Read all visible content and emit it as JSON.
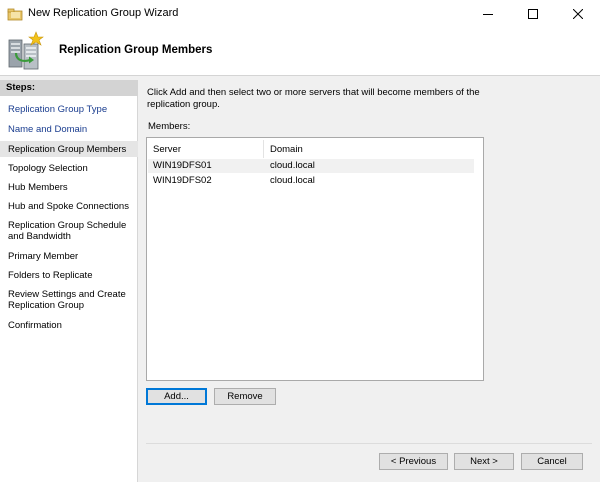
{
  "window": {
    "title": "New Replication Group Wizard",
    "app_icon": "wizard-app-icon",
    "controls": {
      "minimize": "minimize-icon",
      "maximize": "maximize-icon",
      "close": "close-icon"
    }
  },
  "header": {
    "title": "Replication Group Members",
    "icon": "replication-servers-icon"
  },
  "steps": {
    "heading": "Steps:",
    "items": [
      {
        "label": "Replication Group Type",
        "state": "completed"
      },
      {
        "label": "Name and Domain",
        "state": "completed"
      },
      {
        "label": "Replication Group Members",
        "state": "current"
      },
      {
        "label": "Topology Selection",
        "state": "pending"
      },
      {
        "label": "Hub Members",
        "state": "pending"
      },
      {
        "label": "Hub and Spoke Connections",
        "state": "pending"
      },
      {
        "label": "Replication Group Schedule and Bandwidth",
        "state": "pending"
      },
      {
        "label": "Primary Member",
        "state": "pending"
      },
      {
        "label": "Folders to Replicate",
        "state": "pending"
      },
      {
        "label": "Review Settings and Create Replication Group",
        "state": "pending"
      },
      {
        "label": "Confirmation",
        "state": "pending"
      }
    ]
  },
  "main": {
    "instruction": "Click Add and then select two or more servers that will become members of the replication group.",
    "members_label": "Members:",
    "columns": [
      "Server",
      "Domain"
    ],
    "rows": [
      {
        "server": "WIN19DFS01",
        "domain": "cloud.local"
      },
      {
        "server": "WIN19DFS02",
        "domain": "cloud.local"
      }
    ],
    "add_button": "Add...",
    "remove_button": "Remove"
  },
  "footer": {
    "previous_button": "< Previous",
    "next_button": "Next >",
    "cancel_button": "Cancel"
  }
}
